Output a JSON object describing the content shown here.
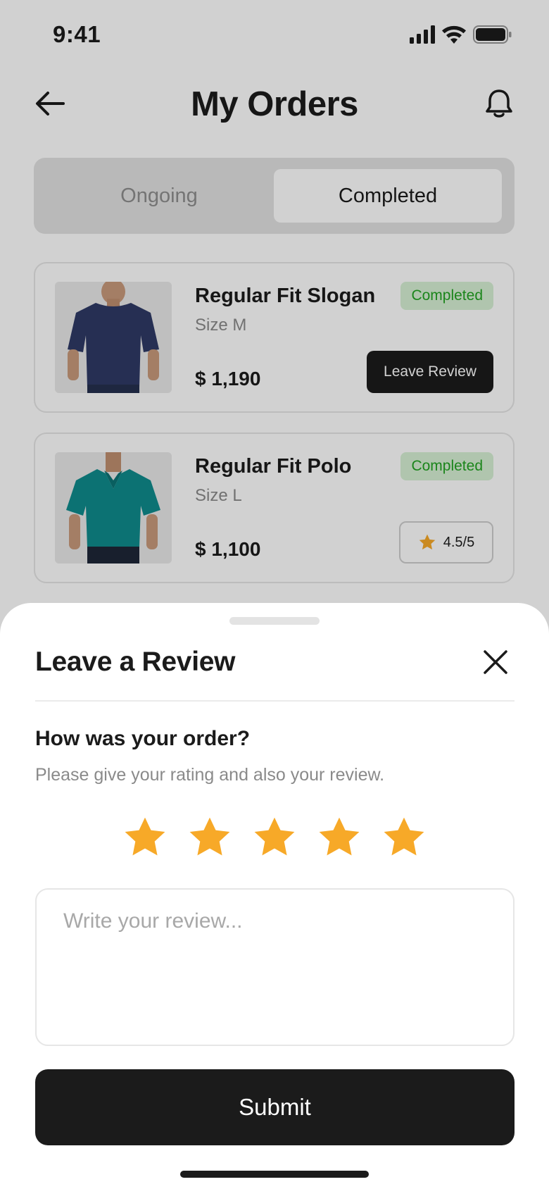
{
  "status_bar": {
    "time": "9:41"
  },
  "header": {
    "title": "My Orders"
  },
  "tabs": [
    {
      "label": "Ongoing",
      "active": false
    },
    {
      "label": "Completed",
      "active": true
    }
  ],
  "orders": [
    {
      "name": "Regular Fit Slogan",
      "size": "Size M",
      "price": "$ 1,190",
      "status": "Completed",
      "action_label": "Leave Review",
      "shirt_color": "#2f3a66"
    },
    {
      "name": "Regular Fit Polo",
      "size": "Size L",
      "price": "$ 1,100",
      "status": "Completed",
      "rating": "4.5/5",
      "shirt_color": "#0f8b8d"
    }
  ],
  "review_sheet": {
    "title": "Leave a Review",
    "question": "How was your order?",
    "subtitle": "Please give your rating and also your review.",
    "rating": 5,
    "max_rating": 5,
    "review_placeholder": "Write your review...",
    "review_value": "",
    "submit_label": "Submit"
  },
  "colors": {
    "accent_star": "#f7a928",
    "badge_bg": "#d7f1d5",
    "badge_text": "#21a321",
    "button_dark": "#1b1b1b"
  },
  "icons": [
    "back-arrow-icon",
    "bell-icon",
    "signal-icon",
    "wifi-icon",
    "battery-icon",
    "star-icon",
    "close-icon"
  ]
}
